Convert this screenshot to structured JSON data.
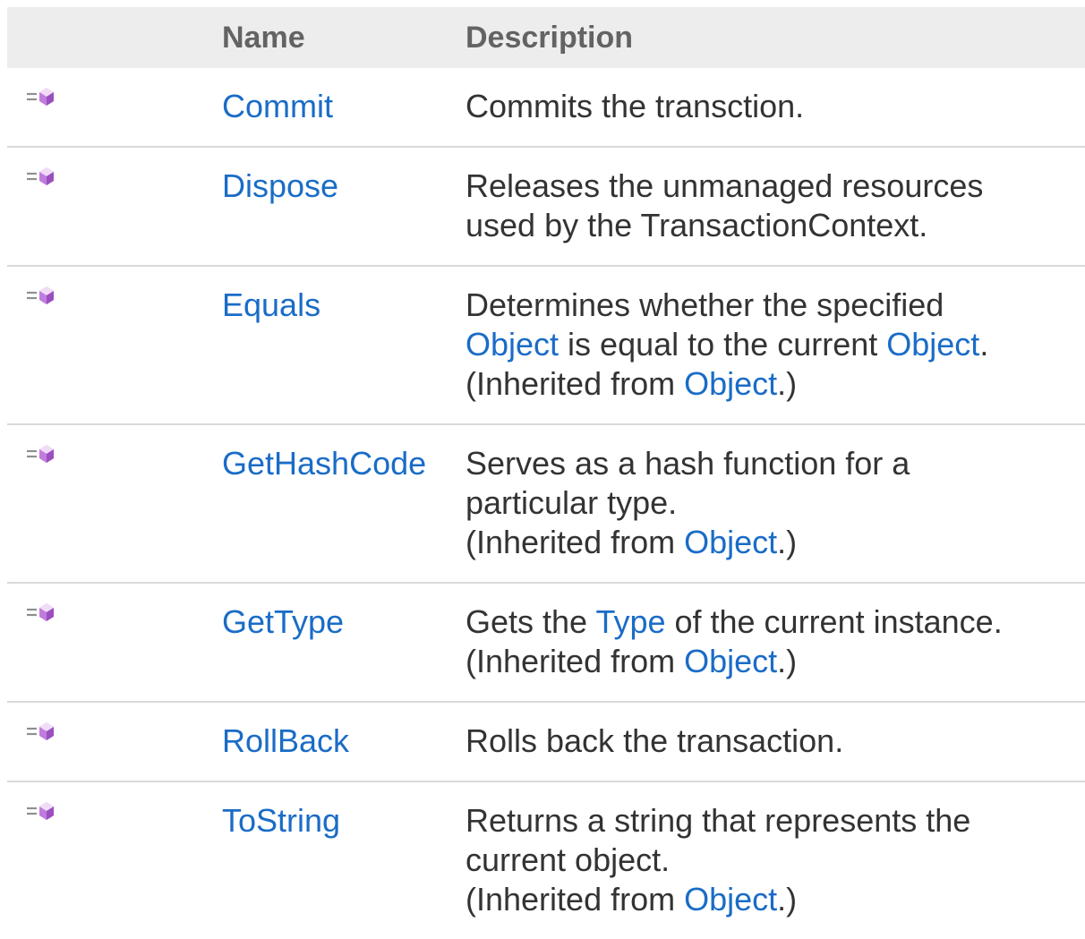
{
  "table": {
    "headers": {
      "icon": "",
      "name": "Name",
      "description": "Description"
    },
    "rows": [
      {
        "icon": "public-method-icon",
        "name": "Commit",
        "desc": [
          "Commits the transction."
        ]
      },
      {
        "icon": "public-method-icon",
        "name": "Dispose",
        "desc": [
          "Releases the unmanaged resources",
          "used by the TransactionContext."
        ]
      },
      {
        "icon": "public-method-icon",
        "name": "Equals",
        "desc_line1": "Determines whether the specified",
        "desc_line2": {
          "link1": "Object",
          "mid": " is equal to the current ",
          "link2": "Object",
          "end": "."
        },
        "inherited": {
          "prefix": "(Inherited from ",
          "link": "Object",
          "suffix": ".)"
        }
      },
      {
        "icon": "public-method-icon",
        "name": "GetHashCode",
        "desc": [
          "Serves as a hash function for a",
          "particular type."
        ],
        "inherited": {
          "prefix": "(Inherited from ",
          "link": "Object",
          "suffix": ".)"
        }
      },
      {
        "icon": "public-method-icon",
        "name": "GetType",
        "desc_line1": {
          "prefix": "Gets the ",
          "link": "Type",
          "suffix": " of the current instance."
        },
        "inherited": {
          "prefix": "(Inherited from ",
          "link": "Object",
          "suffix": ".)"
        }
      },
      {
        "icon": "public-method-icon",
        "name": "RollBack",
        "desc": [
          "Rolls back the transaction."
        ]
      },
      {
        "icon": "public-method-icon",
        "name": "ToString",
        "desc": [
          "Returns a string that represents the",
          "current object."
        ],
        "inherited": {
          "prefix": "(Inherited from ",
          "link": "Object",
          "suffix": ".)"
        }
      }
    ]
  },
  "colors": {
    "link": "#1a6cc7",
    "header_bg": "#ededed",
    "header_text": "#636363",
    "row_divider": "#d9d9d9"
  }
}
